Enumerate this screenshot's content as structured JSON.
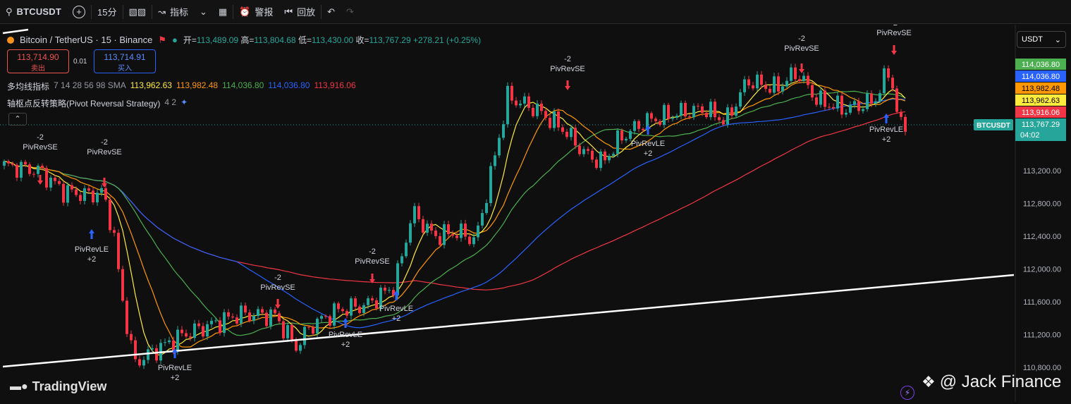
{
  "toolbar": {
    "symbol": "BTCUSDT",
    "interval": "15分",
    "indicators_label": "指标",
    "alert_label": "警报",
    "replay_label": "回放"
  },
  "legend": {
    "title": "Bitcoin / TetherUS · 15 · Binance",
    "open_label": "开=",
    "open": "113,489.09",
    "high_label": "高=",
    "high": "113,804.68",
    "low_label": "低=",
    "low": "113,430.00",
    "close_label": "收=",
    "close": "113,767.29",
    "change": "+278.21 (+0.25%)"
  },
  "trade": {
    "sell_price": "113,714.90",
    "sell_label": "卖出",
    "spread": "0.01",
    "buy_price": "113,714.91",
    "buy_label": "买入"
  },
  "indicator_ma": {
    "name": "多均线指标",
    "params": "7 14 28 56 98 SMA",
    "values": [
      "113,962.63",
      "113,982.48",
      "114,036.80",
      "114,036.80",
      "113,916.06"
    ]
  },
  "indicator_pivot": {
    "name": "轴枢点反转策略(Pivot Reversal Strategy)",
    "params": "4 2"
  },
  "currency": "USDT",
  "axis": {
    "ticks": [
      "113,200.00",
      "112,800.00",
      "112,400.00",
      "112,000.00",
      "111,600.00",
      "111,200.00",
      "110,800.00"
    ],
    "badges": [
      {
        "text": "114,036.80",
        "color": "#4caf50"
      },
      {
        "text": "114,036.80",
        "color": "#2962ff"
      },
      {
        "text": "113,982.48",
        "color": "#ff9800"
      },
      {
        "text": "113,962.63",
        "color": "#ffeb3b"
      },
      {
        "text": "113,916.06",
        "color": "#f23645"
      }
    ],
    "price_badge": {
      "symbol": "BTCUSDT",
      "price": "113,767.29",
      "countdown": "04:02"
    }
  },
  "signals": [
    {
      "type": "short",
      "label": "PivRevSE",
      "qty": "-2"
    },
    {
      "type": "short",
      "label": "PivRevSE",
      "qty": "-2"
    },
    {
      "type": "long",
      "label": "PivRevLE",
      "qty": "+2"
    },
    {
      "type": "long",
      "label": "PivRevLE",
      "qty": "+2"
    },
    {
      "type": "short",
      "label": "PivRevSE",
      "qty": "-2"
    },
    {
      "type": "long",
      "label": "PivRevLE",
      "qty": "+2"
    },
    {
      "type": "short",
      "label": "PivRevSE",
      "qty": "-2"
    },
    {
      "type": "long",
      "label": "PivRevLE",
      "qty": "+2"
    },
    {
      "type": "short",
      "label": "PivRevSE",
      "qty": "-2"
    },
    {
      "type": "long",
      "label": "PivRevLE",
      "qty": "+2"
    },
    {
      "type": "short",
      "label": "PivRevSE",
      "qty": "-2"
    },
    {
      "type": "short",
      "label": "PivRevSE",
      "qty": "-2"
    },
    {
      "type": "long",
      "label": "PivRevLE",
      "qty": "+2"
    }
  ],
  "branding": {
    "logo": "TradingView",
    "watermark": "@ Jack Finance"
  },
  "colors": {
    "up": "#26a69a",
    "down": "#f23645",
    "ma7": "#ffeb3b",
    "ma14": "#ff9800",
    "ma28": "#4caf50",
    "ma56": "#2962ff",
    "ma98": "#f23645"
  }
}
